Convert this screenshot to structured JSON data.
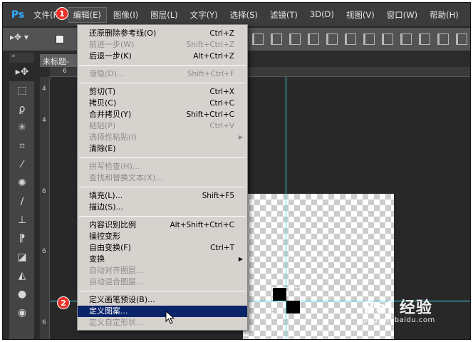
{
  "app": {
    "logo": "Ps"
  },
  "menubar": {
    "items": [
      "文件(F)",
      "编辑(E)",
      "图像(I)",
      "图层(L)",
      "文字(Y)",
      "选择(S)",
      "滤镜(T)",
      "3D(D)",
      "视图(V)",
      "窗口(W)",
      "帮助(H)"
    ],
    "active_index": 1
  },
  "annotations": {
    "step1": "1",
    "step2": "2"
  },
  "document": {
    "tab_title": "未标题-"
  },
  "rulers": {
    "h_ticks": [
      "6"
    ],
    "v_ticks": [
      "4",
      "4",
      "6",
      "6",
      "6"
    ]
  },
  "toolbar": {
    "tools": [
      "move-icon",
      "marquee-icon",
      "lasso-icon",
      "magic-wand-icon",
      "crop-icon",
      "eyedropper-icon",
      "healing-icon",
      "brush-icon",
      "stamp-icon",
      "history-brush-icon",
      "eraser-icon",
      "paint-bucket-icon",
      "blur-icon",
      "dodge-icon"
    ]
  },
  "edit_menu": {
    "items": [
      {
        "label": "还原删除参考线(O)",
        "shortcut": "Ctrl+Z",
        "disabled": false
      },
      {
        "label": "前进一步(W)",
        "shortcut": "Shift+Ctrl+Z",
        "disabled": true
      },
      {
        "label": "后退一步(K)",
        "shortcut": "Alt+Ctrl+Z",
        "disabled": false
      },
      {
        "sep": true
      },
      {
        "label": "渐隐(D)...",
        "shortcut": "Shift+Ctrl+F",
        "disabled": true
      },
      {
        "sep": true
      },
      {
        "label": "剪切(T)",
        "shortcut": "Ctrl+X",
        "disabled": false
      },
      {
        "label": "拷贝(C)",
        "shortcut": "Ctrl+C",
        "disabled": false
      },
      {
        "label": "合并拷贝(Y)",
        "shortcut": "Shift+Ctrl+C",
        "disabled": false
      },
      {
        "label": "粘贴(P)",
        "shortcut": "Ctrl+V",
        "disabled": true
      },
      {
        "label": "选择性粘贴(I)",
        "shortcut": "",
        "disabled": true,
        "submenu": true
      },
      {
        "label": "清除(E)",
        "shortcut": "",
        "disabled": false
      },
      {
        "sep": true
      },
      {
        "label": "拼写检查(H)...",
        "shortcut": "",
        "disabled": true
      },
      {
        "label": "查找和替换文本(X)...",
        "shortcut": "",
        "disabled": true
      },
      {
        "sep": true
      },
      {
        "label": "填充(L)...",
        "shortcut": "Shift+F5",
        "disabled": false
      },
      {
        "label": "描边(S)...",
        "shortcut": "",
        "disabled": false
      },
      {
        "sep": true
      },
      {
        "label": "内容识别比例",
        "shortcut": "Alt+Shift+Ctrl+C",
        "disabled": false
      },
      {
        "label": "操控变形",
        "shortcut": "",
        "disabled": false
      },
      {
        "label": "自由变换(F)",
        "shortcut": "Ctrl+T",
        "disabled": false
      },
      {
        "label": "变换",
        "shortcut": "",
        "disabled": false,
        "submenu": true
      },
      {
        "label": "自动对齐图层...",
        "shortcut": "",
        "disabled": true
      },
      {
        "label": "自动混合图层...",
        "shortcut": "",
        "disabled": true
      },
      {
        "sep": true
      },
      {
        "label": "定义画笔预设(B)...",
        "shortcut": "",
        "disabled": false
      },
      {
        "label": "定义图案...",
        "shortcut": "",
        "disabled": false,
        "highlighted": true
      },
      {
        "label": "定义自定形状...",
        "shortcut": "",
        "disabled": true
      }
    ]
  },
  "watermark": {
    "main": "Bai 经验",
    "sub": "jingyan.baidu.com"
  },
  "colors": {
    "guide": "#3fd8f0",
    "highlight": "#0a246a",
    "badge": "#e8322a",
    "ps_blue": "#31a8ff"
  }
}
